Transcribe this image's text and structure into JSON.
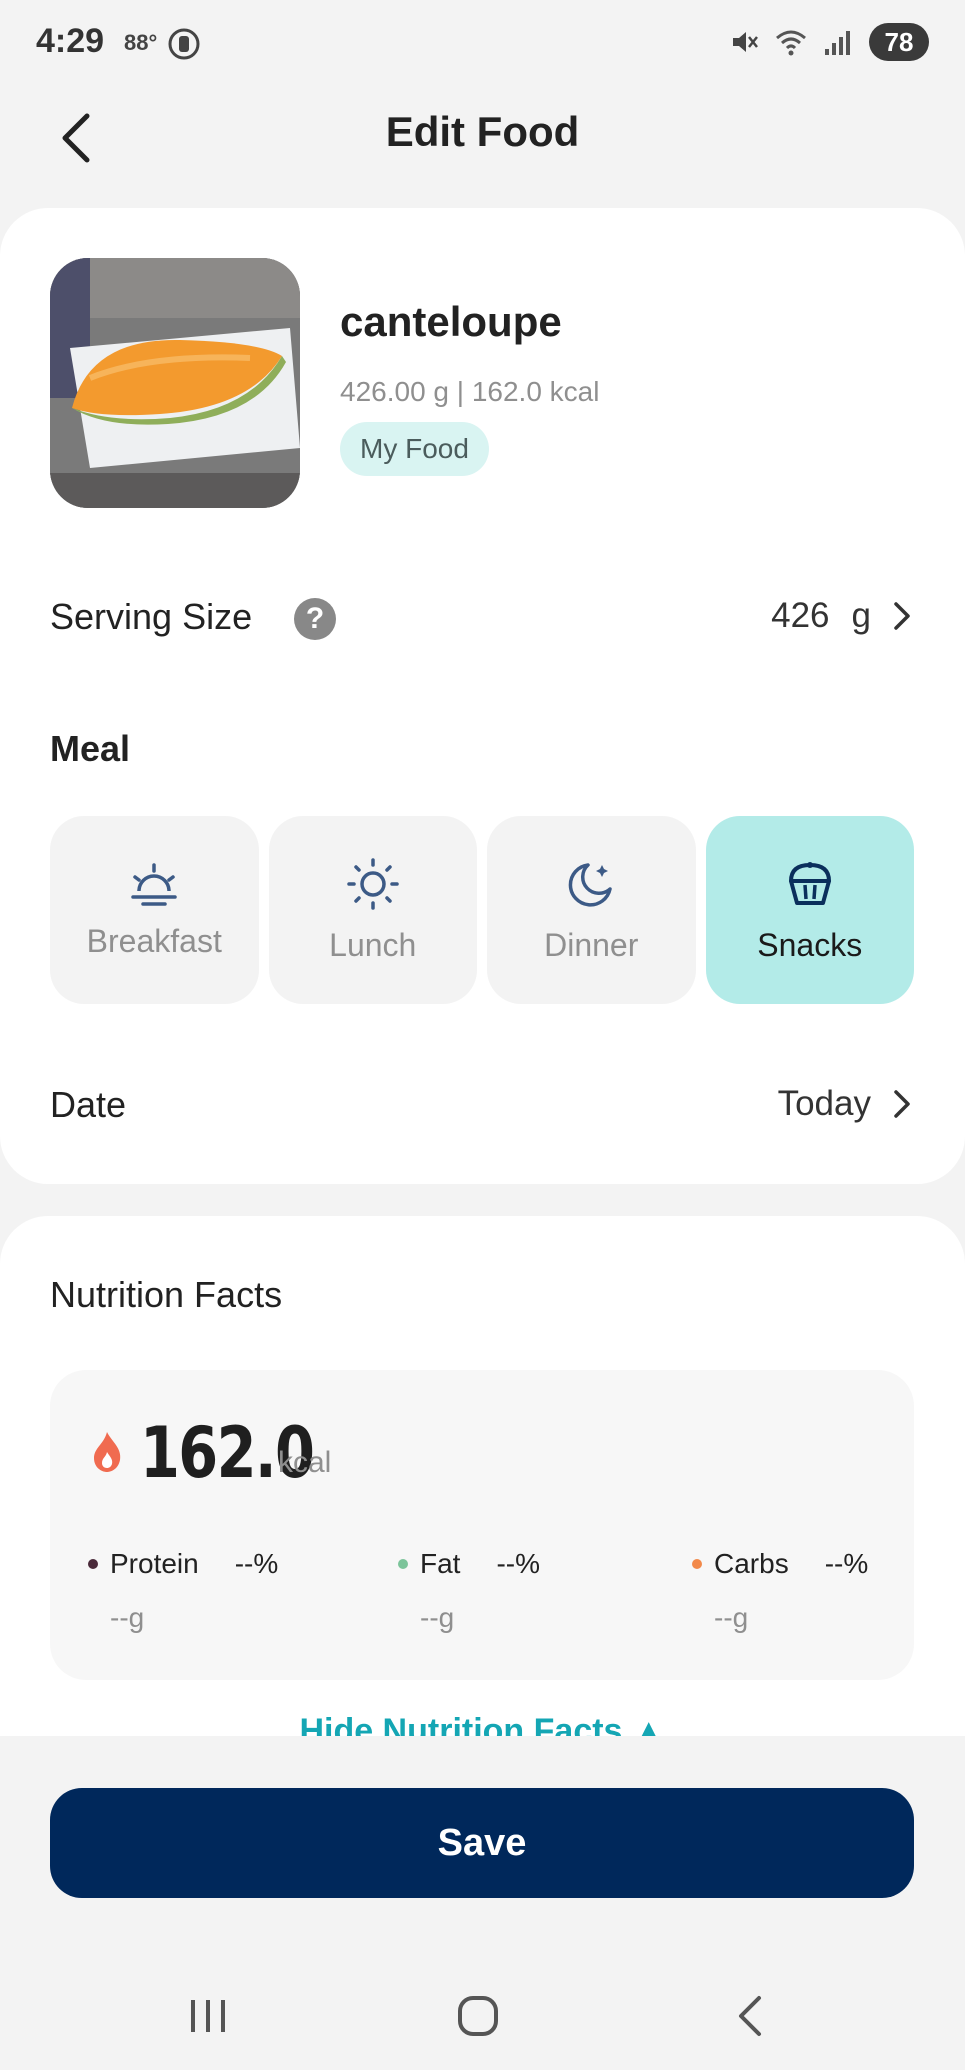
{
  "status_bar": {
    "time": "4:29",
    "temperature": "88°",
    "battery": "78"
  },
  "header": {
    "title": "Edit Food"
  },
  "food": {
    "name": "canteloupe",
    "meta": "426.00 g | 162.0 kcal",
    "tag": "My Food"
  },
  "serving": {
    "label": "Serving Size",
    "help_icon": "?",
    "value": "426",
    "unit": "g"
  },
  "meal": {
    "title": "Meal",
    "options": [
      {
        "label": "Breakfast",
        "icon": "sunrise-icon"
      },
      {
        "label": "Lunch",
        "icon": "sun-icon"
      },
      {
        "label": "Dinner",
        "icon": "moon-icon"
      },
      {
        "label": "Snacks",
        "icon": "muffin-icon"
      }
    ],
    "selected": "Snacks"
  },
  "date": {
    "label": "Date",
    "value": "Today"
  },
  "nutrition": {
    "title": "Nutrition Facts",
    "kcal_value": "162.0",
    "kcal_unit": "kcal",
    "macros": [
      {
        "name": "Protein",
        "pct": "--%",
        "grams": "--g",
        "color": "#4a2a3a"
      },
      {
        "name": "Fat",
        "pct": "--%",
        "grams": "--g",
        "color": "#7cc49a"
      },
      {
        "name": "Carbs",
        "pct": "--%",
        "grams": "--g",
        "color": "#f2894a"
      }
    ],
    "hide_label": "Hide Nutrition Facts ▲"
  },
  "save": {
    "label": "Save"
  },
  "colors": {
    "accent": "#b3ebe8",
    "primary": "#00285b",
    "tag_bg": "#d9f4f2",
    "link": "#14a6b4"
  }
}
